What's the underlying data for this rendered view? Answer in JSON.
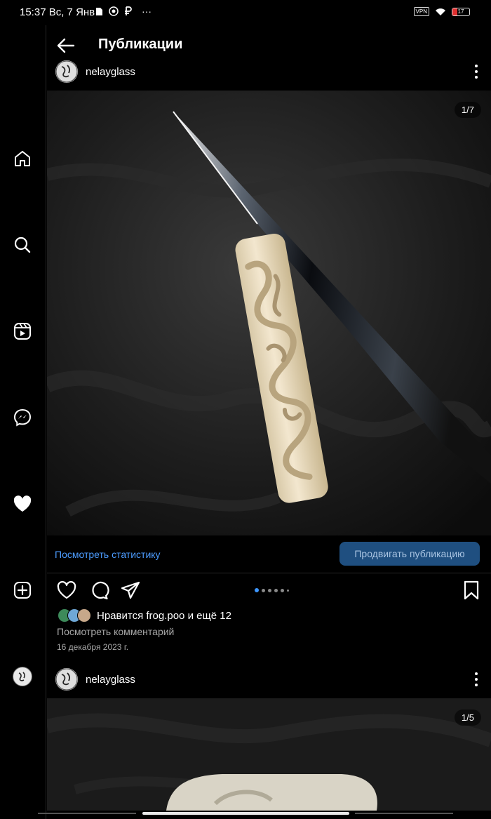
{
  "status_bar": {
    "time": "15:37",
    "date": "Вс, 7 Янв",
    "ellipsis": "···",
    "vpn": "VPN",
    "battery": "17"
  },
  "header": {
    "title": "Публикации"
  },
  "posts": [
    {
      "username": "nelayglass",
      "counter": "1/7",
      "stats_link": "Посмотреть статистику",
      "promote_label": "Продвигать публикацию",
      "likes_text": "Нравится frog.poo и ещё 12",
      "comments_text": "Посмотреть комментарий",
      "date": "16 декабря 2023 г.",
      "carousel": {
        "count": 7,
        "active": 1
      }
    },
    {
      "username": "nelayglass",
      "counter": "1/5"
    }
  ],
  "colors": {
    "accent_blue": "#4c9cff",
    "promote_bg": "#1f4f80",
    "background": "#000000",
    "muted_text": "#a8a8a8"
  },
  "icons": {
    "rail": [
      "home-icon",
      "search-icon",
      "reels-icon",
      "messenger-icon",
      "heart-filled-icon",
      "create-icon",
      "profile-avatar"
    ],
    "actions": [
      "heart-icon",
      "comment-icon",
      "share-icon",
      "bookmark-icon"
    ]
  }
}
